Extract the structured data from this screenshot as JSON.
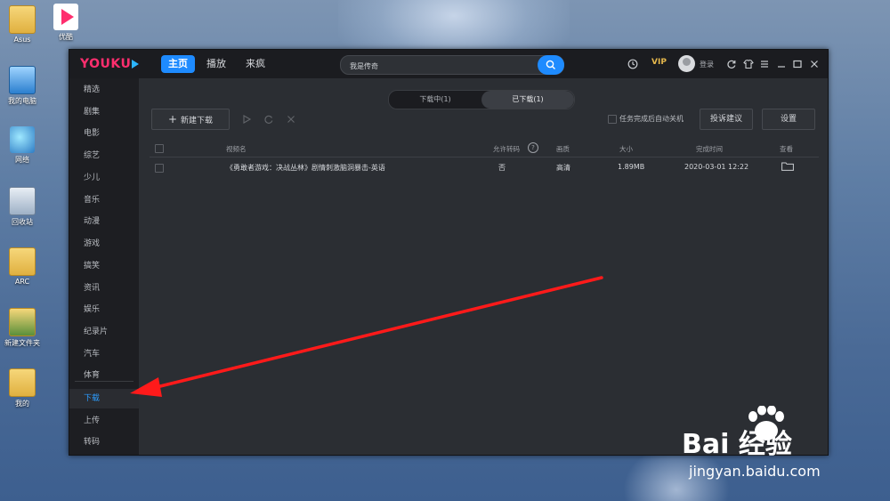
{
  "desktop": {
    "icons": [
      {
        "label": "Asus"
      },
      {
        "label": "优酷"
      },
      {
        "label": "我的电脑"
      },
      {
        "label": "网络"
      },
      {
        "label": "回收站"
      },
      {
        "label": "ARC"
      },
      {
        "label": "新建文件夹"
      },
      {
        "label": "我的"
      }
    ]
  },
  "app": {
    "logo": "YOUKU",
    "nav": {
      "home": "主页",
      "play": "播放",
      "crazy": "来疯"
    },
    "search": {
      "value": "我是传奇"
    },
    "vip": "VIP",
    "login": "登录"
  },
  "sidebar": {
    "items": [
      "精选",
      "剧集",
      "电影",
      "综艺",
      "少儿",
      "音乐",
      "动漫",
      "游戏",
      "搞笑",
      "资讯",
      "娱乐",
      "纪录片",
      "汽车",
      "体育"
    ],
    "bottom": [
      "下载",
      "上传",
      "转码"
    ]
  },
  "downloads": {
    "tabs": {
      "downloading": "下载中(1)",
      "downloaded": "已下载(1)"
    },
    "new_download": "新建下载",
    "auto_shutdown": "任务完成后自动关机",
    "feedback": "投诉建议",
    "settings": "设置",
    "columns": {
      "name": "视频名",
      "transcode": "允许转码",
      "quality": "画质",
      "size": "大小",
      "finished": "完成时间",
      "view": "查看"
    },
    "rows": [
      {
        "name": "《勇敢者游戏：决战丛林》剧情刺激脑洞暴击-英语",
        "transcode": "否",
        "quality": "高清",
        "size": "1.89MB",
        "finished": "2020-03-01 12:22"
      }
    ]
  },
  "watermark": {
    "logo": "Bai 经验",
    "url": "jingyan.baidu.com"
  },
  "colors": {
    "accent": "#1e8bff",
    "youku_pink": "#ff2e6e",
    "vip_gold": "#e6b84c",
    "annotation_red": "#ff1a1a"
  }
}
